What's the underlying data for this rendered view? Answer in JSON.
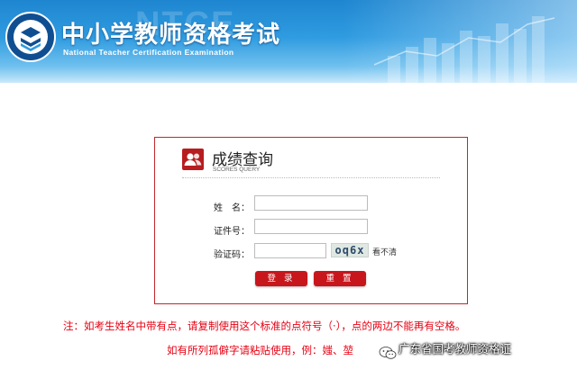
{
  "header": {
    "title": "中小学教师资格考试",
    "subtitle": "National Teacher Certification Examination",
    "watermark": "NTCE",
    "logo_text": "NATIONAL TEACHER CERTIFICATION EXAMINATION"
  },
  "panel": {
    "title": "成绩查询",
    "subtitle": "SCORES QUERY",
    "name_label": "姓　名：",
    "id_label": "证件号：",
    "captcha_label": "验证码：",
    "name_value": "",
    "id_value": "",
    "captcha_value": "",
    "captcha_image_text": "oq6x",
    "refresh_label": "看不清",
    "login_label": "登 录",
    "reset_label": "重 置"
  },
  "notes": {
    "line1": "注：如考生姓名中带有点，请复制使用这个标准的点符号（·），点的两边不能再有空格。",
    "line2": "如有所列孤僻字请粘贴使用，例：",
    "examples": "媸、堃"
  },
  "overlay": {
    "wechat_text": "广东省国考教师资格证"
  },
  "colors": {
    "accent_red": "#c7161c",
    "header_blue": "#1e86d0",
    "note_red": "#e60012"
  }
}
